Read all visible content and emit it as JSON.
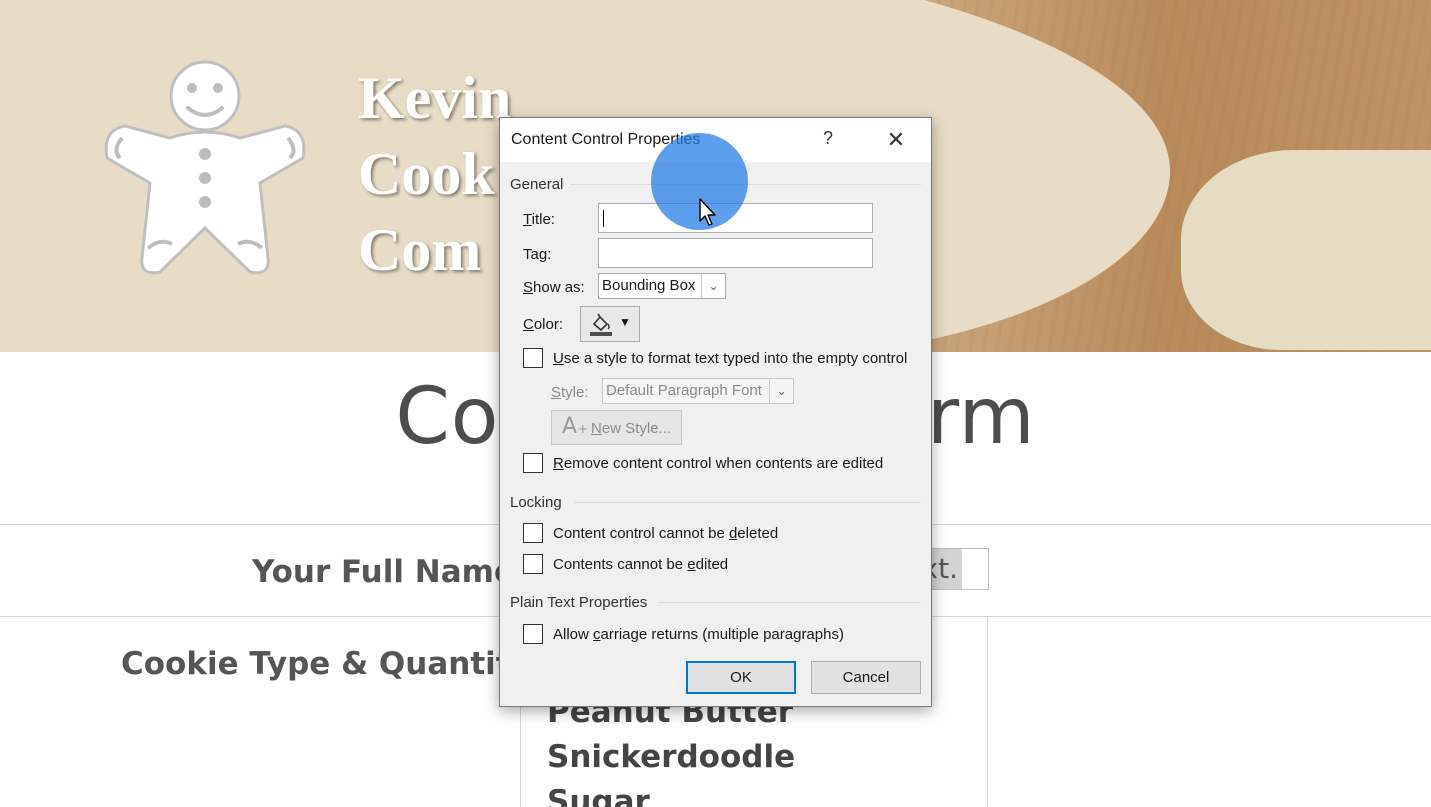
{
  "document": {
    "brand_lines": [
      "Kevin",
      "Cook",
      "Com"
    ],
    "title_left": "Coo",
    "title_right": "orm",
    "full_name_label": "Your Full Name:",
    "placeholder_fragment": "xt.",
    "cookie_type_label": "Cookie Type & Quantity:",
    "cookie_list": [
      "Peanut Butter",
      "Snickerdoodle",
      "Sugar"
    ]
  },
  "dialog": {
    "title": "Content Control Properties",
    "help_label": "?",
    "close_label": "✕",
    "general_section": "General",
    "title_field": {
      "label_access": "T",
      "label_rest": "itle:",
      "value": ""
    },
    "tag_field": {
      "label_pre": "Ta",
      "label_access": "g",
      "label_rest": ":",
      "value": ""
    },
    "show_as": {
      "label_access": "S",
      "label_rest": "how as:",
      "value": "Bounding Box"
    },
    "color": {
      "label_access": "C",
      "label_rest": "olor:",
      "swatch_color": "#4d4d4d"
    },
    "use_style": {
      "checked": false,
      "label_access": "U",
      "label_rest": "se a style to format text typed into the empty control"
    },
    "style": {
      "label_access": "S",
      "label_rest": "tyle:",
      "value": "Default Paragraph Font"
    },
    "new_style": {
      "label_access": "N",
      "label_rest": "ew Style..."
    },
    "remove_control": {
      "checked": false,
      "label_access": "R",
      "label_rest": "emove content control when contents are edited"
    },
    "locking_section": "Locking",
    "cannot_delete": {
      "checked": false,
      "label_pre": "Content control cannot be ",
      "label_access": "d",
      "label_rest": "eleted"
    },
    "cannot_edit": {
      "checked": false,
      "label_pre": "Contents cannot be ",
      "label_access": "e",
      "label_rest": "dited"
    },
    "plain_text_section": "Plain Text Properties",
    "allow_returns": {
      "checked": false,
      "label_pre": "Allow ",
      "label_access": "c",
      "label_rest": "arriage returns (multiple paragraphs)"
    },
    "ok_label": "OK",
    "cancel_label": "Cancel"
  },
  "colors": {
    "accent": "#0078d7",
    "cursor_highlight": "#1e78e6"
  }
}
